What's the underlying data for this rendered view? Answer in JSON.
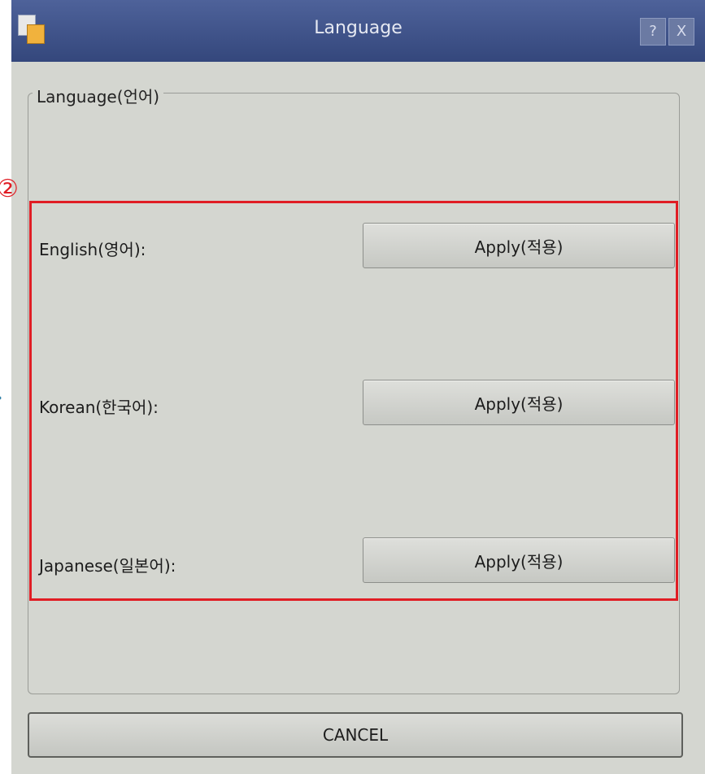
{
  "window": {
    "title": "Language",
    "help_label": "?",
    "close_label": "X"
  },
  "group": {
    "title": "Language(언어)"
  },
  "languages": [
    {
      "label": "English(영어):",
      "apply_label": "Apply(적용)"
    },
    {
      "label": "Korean(한국어):",
      "apply_label": "Apply(적용)"
    },
    {
      "label": "Japanese(일본어):",
      "apply_label": "Apply(적용)"
    }
  ],
  "cancel_label": "CANCEL",
  "annotation": {
    "step_marker": "②",
    "highlight_color": "#e01d24"
  }
}
